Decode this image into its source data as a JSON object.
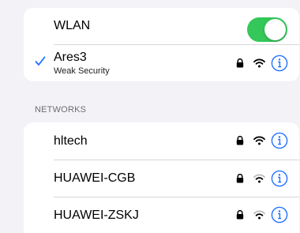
{
  "wlan": {
    "label": "WLAN",
    "enabled": true,
    "toggle_color": "#34c759"
  },
  "connected": {
    "name": "Ares3",
    "subtitle": "Weak Security",
    "check_color": "#1e6fff",
    "icons": [
      "lock-icon",
      "wifi-icon",
      "info-icon"
    ]
  },
  "networks_header": "NETWORKS",
  "networks": [
    {
      "name": "hltech",
      "icons": [
        "lock-icon",
        "wifi-icon",
        "info-icon"
      ]
    },
    {
      "name": "HUAWEI-CGB",
      "icons": [
        "lock-icon",
        "wifi-icon",
        "info-icon"
      ]
    },
    {
      "name": "HUAWEI-ZSKJ",
      "icons": [
        "lock-icon",
        "wifi-icon",
        "info-icon"
      ]
    }
  ],
  "accent_color": "#1e6fff"
}
